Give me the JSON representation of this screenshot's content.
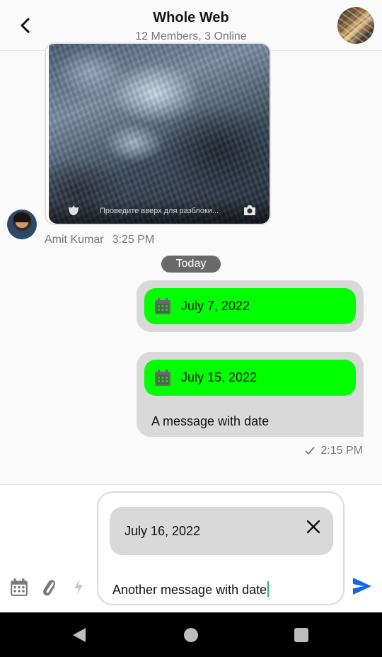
{
  "header": {
    "title": "Whole Web",
    "subtitle": "12 Members, 3 Online"
  },
  "image_message": {
    "lock_text": "Проведите вверх для разблоки...",
    "sender_name": "Amit Kumar",
    "time": "3:25 PM"
  },
  "day_divider": "Today",
  "sent_messages": [
    {
      "date": "July 7, 2022"
    },
    {
      "date": "July 15, 2022",
      "text": "A message with date"
    }
  ],
  "sent_meta": {
    "time": "2:15 PM",
    "status_icon": "check-icon"
  },
  "composer": {
    "attached_date": "July 16, 2022",
    "input_value": "Another message with date",
    "tools": [
      "calendar-icon",
      "paperclip-icon",
      "bolt-icon"
    ],
    "send_icon": "send-icon"
  },
  "colors": {
    "date_chip": "#00ff00",
    "bubble": "#d9d9d9",
    "send_accent": "#1565e8",
    "caret": "#20b2aa"
  }
}
